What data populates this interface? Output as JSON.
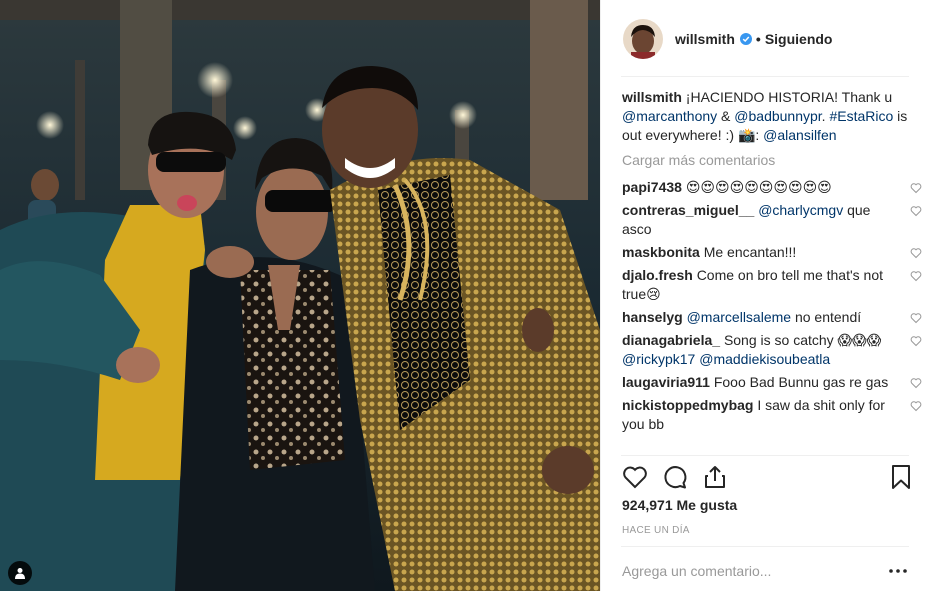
{
  "post": {
    "username": "willsmith",
    "follow_separator": "•",
    "follow_status": "Siguiendo",
    "caption": {
      "username": "willsmith",
      "text_1": "¡HACIENDO HISTORIA! Thank u ",
      "mention_1": "@marcanthony",
      "text_2": " & ",
      "mention_2": "@badbunnypr",
      "text_3": ". ",
      "hashtag": "#EstaRico",
      "text_4": " is out everywhere! :) 📸: ",
      "mention_3": "@alansilfen"
    },
    "load_more": "Cargar más comentarios",
    "comments": [
      {
        "user": "papi7438",
        "text": "😍😍😍😍😍😍😍😍😍😍"
      },
      {
        "user": "contreras_miguel__",
        "mention": "@charlycmgv",
        "text": " que asco"
      },
      {
        "user": "maskbonita",
        "text": "Me encantan!!!"
      },
      {
        "user": "djalo.fresh",
        "text": "Come on bro tell me that's not true😢"
      },
      {
        "user": "hanselyg",
        "mention": "@marcellsaleme",
        "text": " no entendí"
      },
      {
        "user": "dianagabriela_",
        "text": "Song is so catchy 😱😱😱 ",
        "mention": "@rickypk17",
        "mention_b": "@maddiekisoubeatla"
      },
      {
        "user": "laugaviria911",
        "text": "Fooo Bad Bunnu gas re gas"
      },
      {
        "user": "nickistoppedmybag",
        "text": "I saw da shit only for you bb"
      }
    ],
    "likes": "924,971 Me gusta",
    "time": "HACE UN DÍA",
    "comment_placeholder": "Agrega un comentario...",
    "more_label": "•••"
  },
  "icons": {
    "verified": "verified-badge-icon",
    "heart": "heart-icon",
    "comment": "comment-icon",
    "share": "share-icon",
    "bookmark": "bookmark-icon",
    "tag": "user-tag-icon",
    "more": "more-options-icon"
  },
  "colors": {
    "verified_blue": "#3897f0",
    "mention": "#003569",
    "muted": "#999999",
    "text": "#262626"
  }
}
